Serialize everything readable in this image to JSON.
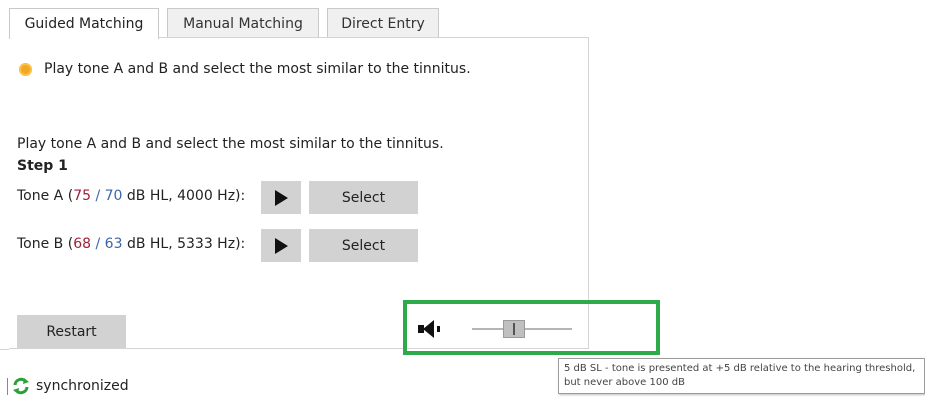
{
  "tabs": [
    {
      "label": "Guided Matching",
      "active": true
    },
    {
      "label": "Manual Matching",
      "active": false
    },
    {
      "label": "Direct Entry",
      "active": false
    }
  ],
  "instruction_banner": "Play tone A and B and select the most similar to the tinnitus.",
  "instruction_text": "Play tone A and B and select the most similar to the tinnitus.",
  "step_label": "Step 1",
  "tone_a": {
    "name": "Tone A",
    "level_right": "75",
    "separator": "/",
    "level_left": "70",
    "units": "dB HL, 4000 Hz",
    "select_label": "Select"
  },
  "tone_b": {
    "name": "Tone B",
    "level_right": "68",
    "separator": "/",
    "level_left": "63",
    "units": "dB HL, 5333 Hz",
    "select_label": "Select"
  },
  "restart_label": "Restart",
  "volume_slider": {
    "value_fraction": 0.42
  },
  "tooltip": {
    "line1": "5 dB SL - tone is presented at +5 dB relative to the hearing threshold,",
    "line2": "but never above 100 dB"
  },
  "status": {
    "text": "synchronized"
  },
  "colors": {
    "level_right": "#a0213a",
    "level_left": "#3b67a8",
    "highlight": "#2eaa4a",
    "info": "#f5a623",
    "sync": "#2e9e3a"
  }
}
